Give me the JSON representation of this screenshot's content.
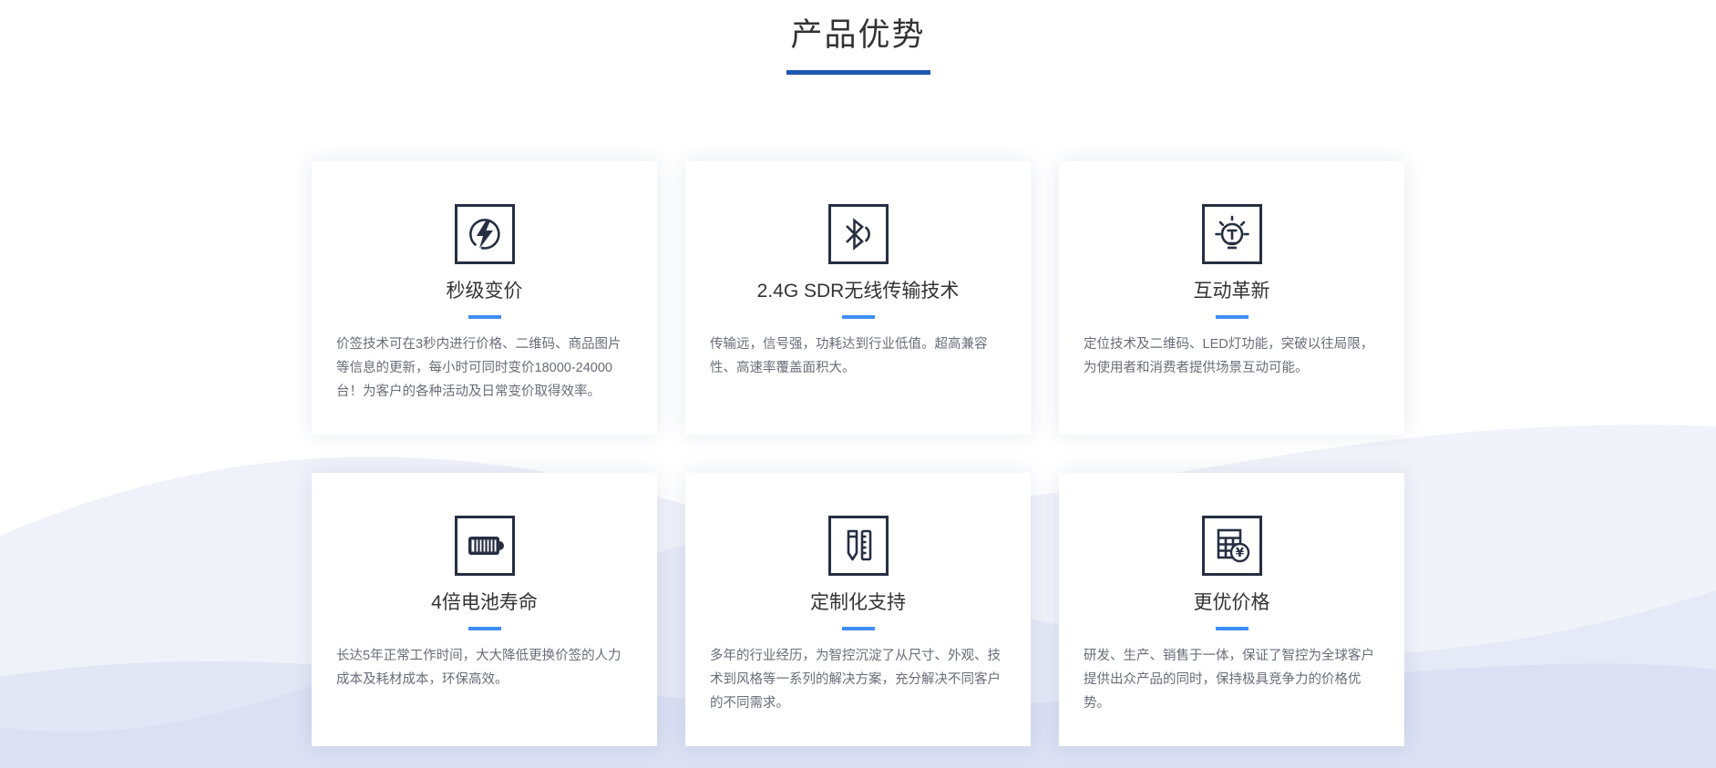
{
  "header": {
    "title": "产品优势"
  },
  "theme": {
    "title_underline_color": "#1e56b0",
    "card_divider_color": "#3e8ef5",
    "icon_color": "#262f42",
    "wave_color": "#dde2f4"
  },
  "cards": [
    {
      "icon": "flash-circle-icon",
      "title": "秒级变价",
      "description": "价签技术可在3秒内进行价格、二维码、商品图片等信息的更新，每小时可同时变价18000-24000台！为客户的各种活动及日常变价取得效率。"
    },
    {
      "icon": "bluetooth-icon",
      "title": "2.4G SDR无线传输技术",
      "description": "传输远，信号强，功耗达到行业低值。超高兼容性、高速率覆盖面积大。"
    },
    {
      "icon": "lightbulb-icon",
      "title": "互动革新",
      "description": "定位技术及二维码、LED灯功能，突破以往局限，为使用者和消费者提供场景互动可能。"
    },
    {
      "icon": "battery-icon",
      "title": "4倍电池寿命",
      "description": "长达5年正常工作时间，大大降低更换价签的人力成本及耗材成本，环保高效。"
    },
    {
      "icon": "pencil-ruler-icon",
      "title": "定制化支持",
      "description": "多年的行业经历，为智控沉淀了从尺寸、外观、技术到风格等一系列的解决方案，充分解决不同客户的不同需求。"
    },
    {
      "icon": "calculator-yuan-icon",
      "title": "更优价格",
      "description": "研发、生产、销售于一体，保证了智控为全球客户提供出众产品的同时，保持极具竞争力的价格优势。"
    }
  ]
}
